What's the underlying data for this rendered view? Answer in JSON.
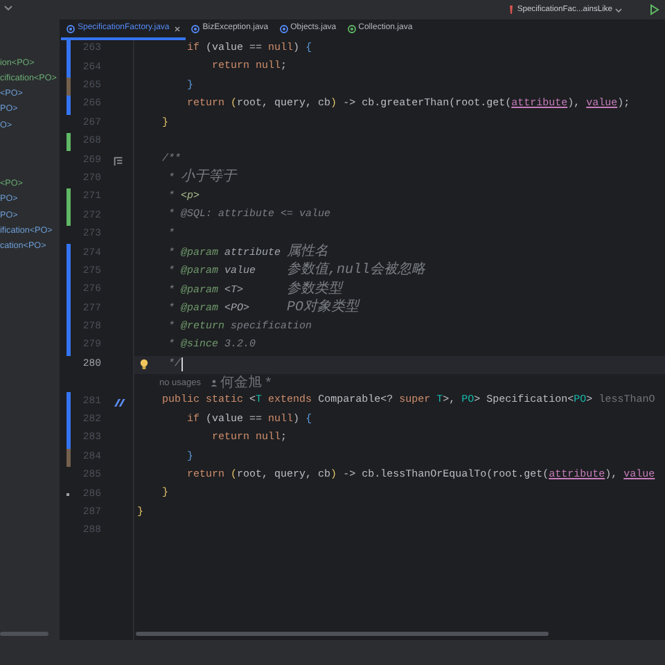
{
  "top_bar": {
    "run_configuration": "SpecificationFac...ainsLike"
  },
  "sidebar": {
    "sections": [
      {
        "items": [
          {
            "text": "ion<PO>",
            "color": "#6aab73"
          },
          {
            "text": "cification<PO>",
            "color": "#6aab73"
          },
          {
            "text": "<PO>",
            "color": "#6f9fd8"
          },
          {
            "text": "PO>",
            "color": "#6f9fd8"
          },
          {
            "text": "O>",
            "color": "#6f9fd8"
          }
        ]
      },
      {
        "items": [
          {
            "text": "<PO>",
            "color": "#6aab73"
          },
          {
            "text": "PO>",
            "color": "#6f9fd8"
          },
          {
            "text": "PO>",
            "color": "#6f9fd8"
          },
          {
            "text": "ification<PO>",
            "color": "#6f9fd8"
          },
          {
            "text": "cation<PO>",
            "color": "#6f9fd8"
          }
        ]
      }
    ]
  },
  "tabs": [
    {
      "label": "SpecificationFactory.java",
      "selected": true,
      "kind": "class",
      "closable": true
    },
    {
      "label": "BizException.java",
      "selected": false,
      "kind": "class",
      "closable": false
    },
    {
      "label": "Objects.java",
      "selected": false,
      "kind": "class",
      "closable": false
    },
    {
      "label": "Collection.java",
      "selected": false,
      "kind": "interface",
      "closable": false
    }
  ],
  "editor": {
    "lines": [
      {
        "kind": "code",
        "number": "263",
        "color": "#3574f0",
        "current": false,
        "tokens": [
          {
            "text": "        if",
            "kind": "kw"
          },
          {
            "text": " (value == ",
            "kind": "p"
          },
          {
            "text": "null",
            "kind": "kw"
          },
          {
            "text": ") ",
            "kind": "p"
          },
          {
            "text": "{",
            "kind": "bb"
          }
        ]
      },
      {
        "kind": "code",
        "number": "264",
        "color": "#3574f0",
        "current": false,
        "tokens": [
          {
            "text": "            return null",
            "kind": "kw"
          },
          {
            "text": ";",
            "kind": "p"
          }
        ]
      },
      {
        "kind": "code",
        "number": "265",
        "color": "#73604c",
        "current": false,
        "tokens": [
          {
            "text": "        }",
            "kind": "bb"
          }
        ]
      },
      {
        "kind": "code",
        "number": "266",
        "color": "#3574f0",
        "current": false,
        "tokens": [
          {
            "text": "        return ",
            "kind": "kw"
          },
          {
            "text": "(",
            "kind": "by"
          },
          {
            "text": "root, query, cb",
            "kind": "p"
          },
          {
            "text": ")",
            "kind": "by"
          },
          {
            "text": " -> cb.greaterThan(root.get(",
            "kind": "p"
          },
          {
            "text": "attribute",
            "kind": "param"
          },
          {
            "text": "), ",
            "kind": "p"
          },
          {
            "text": "value",
            "kind": "param"
          },
          {
            "text": ");",
            "kind": "p"
          }
        ]
      },
      {
        "kind": "code",
        "number": "267",
        "current": false,
        "tokens": [
          {
            "text": "    }",
            "kind": "by"
          }
        ]
      },
      {
        "kind": "code",
        "number": "268",
        "color": "#5fb865",
        "current": false
      },
      {
        "kind": "code",
        "number": "269",
        "gutter_icon": {
          "kind": "doc"
        },
        "current": false,
        "tokens": [
          {
            "text": "    /**",
            "kind": "cm"
          }
        ]
      },
      {
        "kind": "code",
        "number": "270",
        "current": false,
        "tokens": [
          {
            "text": "     * ",
            "kind": "cm"
          },
          {
            "text": "小于等于",
            "kind": "cjk"
          }
        ]
      },
      {
        "kind": "code",
        "number": "271",
        "color": "#5fb865",
        "current": false,
        "tokens": [
          {
            "text": "     * ",
            "kind": "cm"
          },
          {
            "text": "<p>",
            "kind": "html"
          }
        ]
      },
      {
        "kind": "code",
        "number": "272",
        "color": "#5fb865",
        "current": false,
        "tokens": [
          {
            "text": "     * @SQL: attribute <= value",
            "kind": "cm"
          }
        ]
      },
      {
        "kind": "code",
        "number": "273",
        "current": false,
        "tokens": [
          {
            "text": "     *",
            "kind": "cm"
          }
        ]
      },
      {
        "kind": "code",
        "number": "274",
        "color": "#3574f0",
        "current": false,
        "tokens": [
          {
            "text": "     * ",
            "kind": "cm"
          },
          {
            "text": "@param",
            "kind": "tag"
          },
          {
            "text": " attribute ",
            "kind": "dn"
          },
          {
            "text": "属性名",
            "kind": "cjk"
          }
        ]
      },
      {
        "kind": "code",
        "number": "275",
        "color": "#3574f0",
        "current": false,
        "tokens": [
          {
            "text": "     * ",
            "kind": "cm"
          },
          {
            "text": "@param",
            "kind": "tag"
          },
          {
            "text": " value     ",
            "kind": "dn"
          },
          {
            "text": "参数值,null会被忽略",
            "kind": "cjk"
          }
        ]
      },
      {
        "kind": "code",
        "number": "276",
        "color": "#3574f0",
        "current": false,
        "tokens": [
          {
            "text": "     * ",
            "kind": "cm"
          },
          {
            "text": "@param",
            "kind": "tag"
          },
          {
            "text": " <T>       ",
            "kind": "dn"
          },
          {
            "text": "参数类型",
            "kind": "cjk"
          }
        ]
      },
      {
        "kind": "code",
        "number": "277",
        "color": "#3574f0",
        "current": false,
        "tokens": [
          {
            "text": "     * ",
            "kind": "cm"
          },
          {
            "text": "@param",
            "kind": "tag"
          },
          {
            "text": " <PO>      ",
            "kind": "dn"
          },
          {
            "text": "PO对象类型",
            "kind": "cjk"
          }
        ]
      },
      {
        "kind": "code",
        "number": "278",
        "color": "#3574f0",
        "current": false,
        "tokens": [
          {
            "text": "     * ",
            "kind": "cm"
          },
          {
            "text": "@return",
            "kind": "tag"
          },
          {
            "text": " specification",
            "kind": "cm"
          }
        ]
      },
      {
        "kind": "code",
        "number": "279",
        "color": "#3574f0",
        "current": false,
        "tokens": [
          {
            "text": "     * ",
            "kind": "cm"
          },
          {
            "text": "@since",
            "kind": "tag"
          },
          {
            "text": " 3.2.0",
            "kind": "cm"
          }
        ]
      },
      {
        "kind": "code",
        "number": "280",
        "gutter_icon": {
          "kind": "bulb"
        },
        "current": true,
        "tokens": [
          {
            "text": "     */",
            "kind": "cm"
          }
        ]
      },
      {
        "kind": "inlay",
        "usages": "no usages",
        "author": "何金旭 *"
      },
      {
        "kind": "code",
        "number": "281",
        "color": "#3574f0",
        "gutter_icon": {
          "kind": "implement"
        },
        "current": false,
        "tokens": [
          {
            "text": "    public static ",
            "kind": "kw"
          },
          {
            "text": "<",
            "kind": "p"
          },
          {
            "text": "T",
            "kind": "type"
          },
          {
            "text": " extends",
            "kind": "kw"
          },
          {
            "text": " Comparable<? ",
            "kind": "p"
          },
          {
            "text": "super ",
            "kind": "kw"
          },
          {
            "text": "T",
            "kind": "type"
          },
          {
            "text": ">, ",
            "kind": "p"
          },
          {
            "text": "PO",
            "kind": "type"
          },
          {
            "text": "> Specification<",
            "kind": "p"
          },
          {
            "text": "PO",
            "kind": "type"
          },
          {
            "text": "> ",
            "kind": "p"
          },
          {
            "text": "lessThanO",
            "kind": "dim"
          }
        ]
      },
      {
        "kind": "code",
        "number": "282",
        "color": "#3574f0",
        "current": false,
        "tokens": [
          {
            "text": "        if",
            "kind": "kw"
          },
          {
            "text": " (value == ",
            "kind": "p"
          },
          {
            "text": "null",
            "kind": "kw"
          },
          {
            "text": ") ",
            "kind": "p"
          },
          {
            "text": "{",
            "kind": "bb"
          }
        ]
      },
      {
        "kind": "code",
        "number": "283",
        "color": "#3574f0",
        "current": false,
        "tokens": [
          {
            "text": "            return null",
            "kind": "kw"
          },
          {
            "text": ";",
            "kind": "p"
          }
        ]
      },
      {
        "kind": "code",
        "number": "284",
        "color": "#73604c",
        "current": false,
        "tokens": [
          {
            "text": "        }",
            "kind": "bb"
          }
        ]
      },
      {
        "kind": "code",
        "number": "285",
        "current": false,
        "tokens": [
          {
            "text": "        return ",
            "kind": "kw"
          },
          {
            "text": "(",
            "kind": "by"
          },
          {
            "text": "root, query, cb",
            "kind": "p"
          },
          {
            "text": ")",
            "kind": "by"
          },
          {
            "text": " -> cb.lessThanOrEqualTo(root.get(",
            "kind": "p"
          },
          {
            "text": "attribute",
            "kind": "param"
          },
          {
            "text": "), ",
            "kind": "p"
          },
          {
            "text": "value",
            "kind": "param"
          }
        ]
      },
      {
        "kind": "code",
        "number": "286",
        "deleted": true,
        "current": false,
        "tokens": [
          {
            "text": "    }",
            "kind": "by"
          }
        ]
      },
      {
        "kind": "code",
        "number": "287",
        "current": false,
        "tokens": [
          {
            "text": "}",
            "kind": "by"
          }
        ]
      },
      {
        "kind": "code",
        "number": "288",
        "current": false
      }
    ]
  }
}
